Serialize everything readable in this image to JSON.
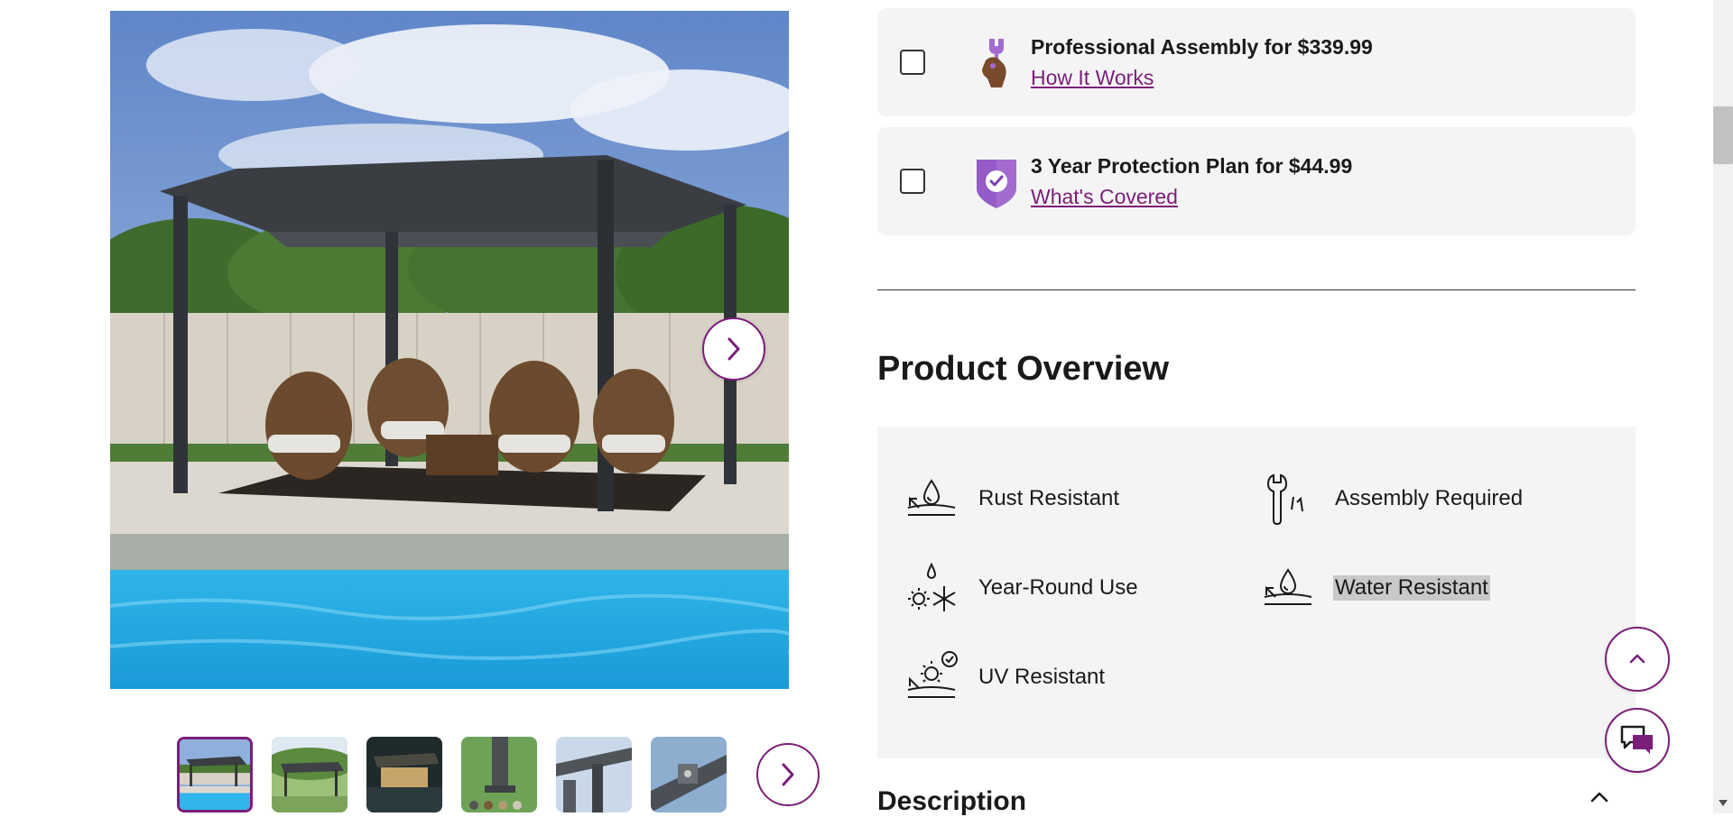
{
  "gallery": {
    "main_image_alt": "Gray pergola with retractable canopy over wicker chairs beside a swimming pool",
    "thumbnail_count": 6,
    "selected_thumbnail": 1
  },
  "options": [
    {
      "title": "Professional Assembly for $339.99",
      "link": "How It Works",
      "icon": "assembly-hand-wrench-icon"
    },
    {
      "title": "3 Year Protection Plan for $44.99",
      "link": "What's Covered",
      "icon": "protection-shield-icon"
    }
  ],
  "overview": {
    "heading": "Product Overview",
    "features": [
      {
        "label": "Rust Resistant",
        "icon": "rust-resistant-icon"
      },
      {
        "label": "Assembly Required",
        "icon": "assembly-required-icon"
      },
      {
        "label": "Year-Round Use",
        "icon": "year-round-use-icon"
      },
      {
        "label": "Water Resistant",
        "icon": "water-resistant-icon",
        "highlighted": true
      },
      {
        "label": "UV Resistant",
        "icon": "uv-resistant-icon"
      }
    ]
  },
  "description": {
    "title": "Description",
    "expanded": true
  },
  "colors": {
    "brand": "#7b1e7a",
    "panel_bg": "#f4f4f4",
    "shield": "#a36ad0"
  }
}
